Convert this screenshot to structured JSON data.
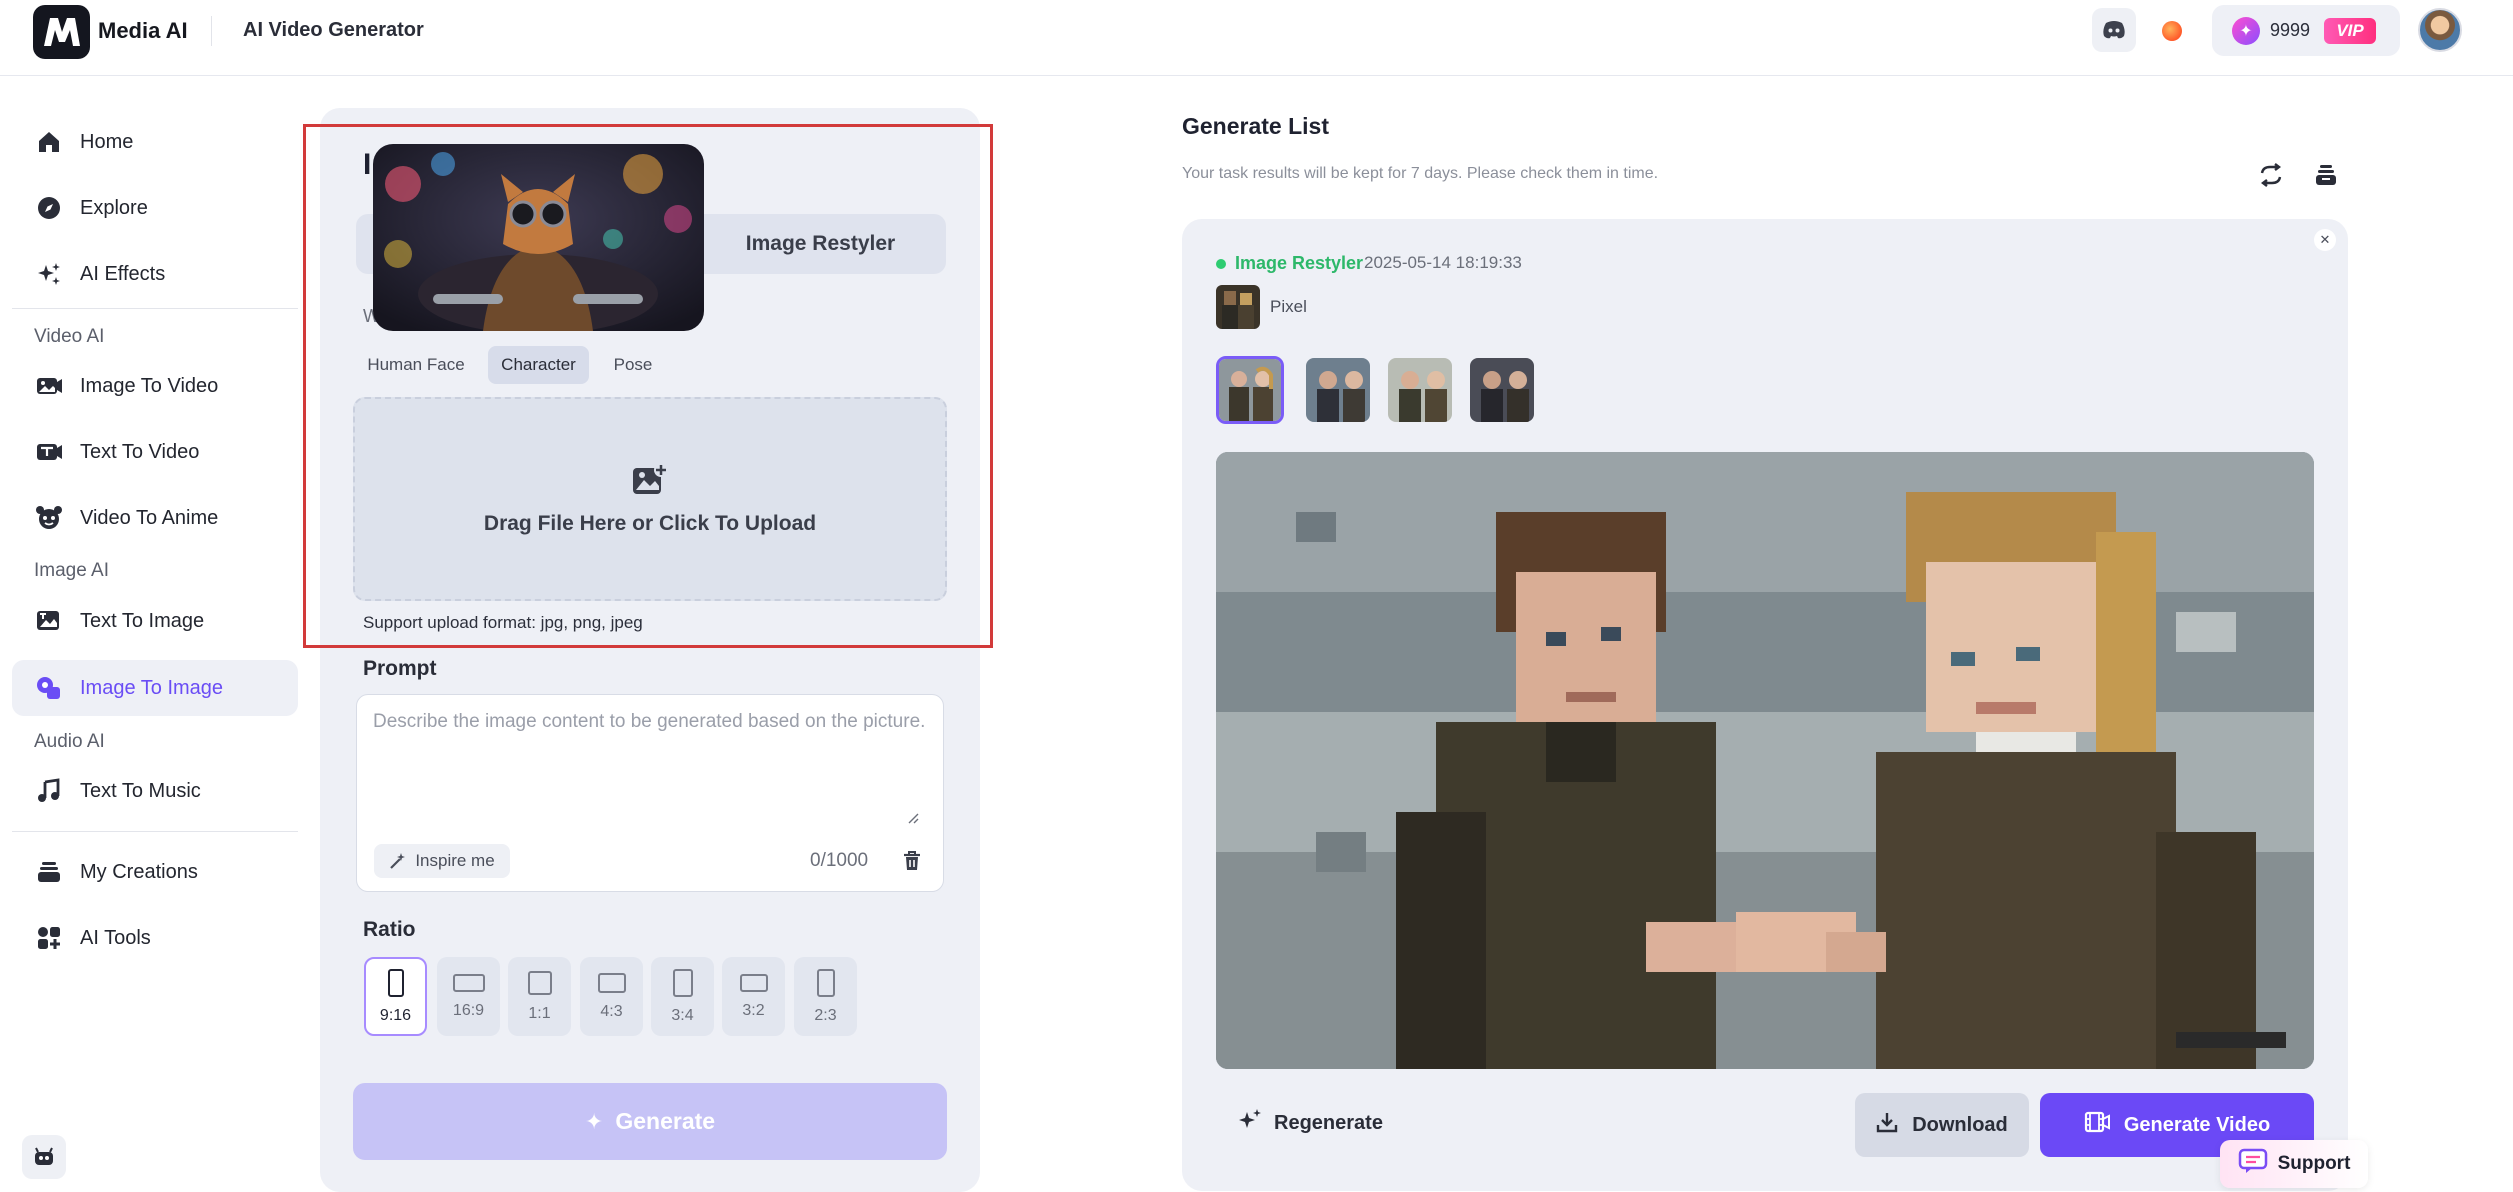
{
  "header": {
    "brand": "Media AI",
    "app_title": "AI Video Generator",
    "credits": "9999",
    "vip": "VIP"
  },
  "sidebar": {
    "items_top": [
      {
        "label": "Home",
        "icon": "home-icon"
      },
      {
        "label": "Explore",
        "icon": "compass-icon"
      },
      {
        "label": "AI Effects",
        "icon": "sparkles-icon"
      }
    ],
    "video_section": "Video AI",
    "video_items": [
      {
        "label": "Image To Video",
        "icon": "image-video-icon"
      },
      {
        "label": "Text To Video",
        "icon": "text-video-icon"
      },
      {
        "label": "Video To Anime",
        "icon": "anime-icon"
      }
    ],
    "image_section": "Image AI",
    "image_items": [
      {
        "label": "Text To Image",
        "icon": "text-image-icon"
      },
      {
        "label": "Image To Image",
        "icon": "image-image-icon",
        "active": true
      }
    ],
    "audio_section": "Audio AI",
    "audio_items": [
      {
        "label": "Text To Music",
        "icon": "music-icon"
      }
    ],
    "items_bottom": [
      {
        "label": "My Creations",
        "icon": "stack-icon"
      },
      {
        "label": "AI Tools",
        "icon": "grid-icon"
      }
    ]
  },
  "panel": {
    "heading_stub": "I",
    "tab_restyler": "Image Restyler",
    "stub_w": "W",
    "sub_tabs": [
      "Human Face",
      "Character",
      "Pose"
    ],
    "active_sub_tab": "Character",
    "upload_text": "Drag File Here or Click To Upload",
    "support_format": "Support upload format: jpg, png, jpeg",
    "prompt_label": "Prompt",
    "prompt_placeholder": "Describe the image content to be generated based on the picture.",
    "prompt_value": "",
    "inspire": "Inspire me",
    "char_count": "0/1000",
    "ratio_label": "Ratio",
    "ratios": [
      "9:16",
      "16:9",
      "1:1",
      "4:3",
      "3:4",
      "3:2",
      "2:3"
    ],
    "active_ratio": "9:16",
    "generate": "Generate"
  },
  "generate_list": {
    "title": "Generate List",
    "subtitle": "Your task results will be kept for 7 days. Please check them in time.",
    "task": {
      "type": "Image Restyler",
      "timestamp": "2025-05-14 18:19:33",
      "style": "Pixel"
    },
    "regenerate": "Regenerate",
    "download": "Download",
    "generate_video": "Generate Video",
    "support": "Support"
  },
  "colors": {
    "accent": "#6b49f6",
    "status_green": "#2db86a",
    "highlight_frame": "#d23a3a"
  }
}
